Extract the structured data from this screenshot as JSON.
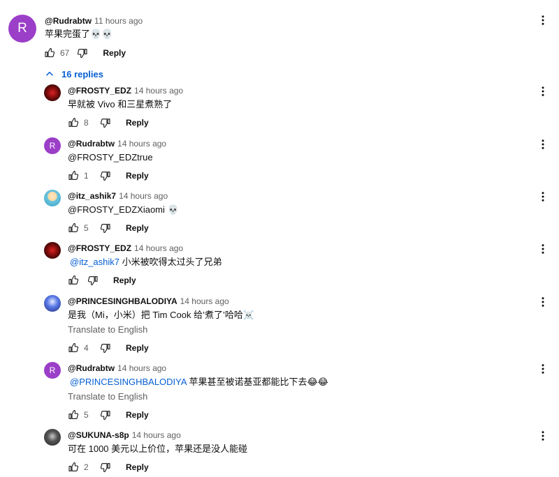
{
  "top_comment": {
    "avatar_letter": "R",
    "author": "@Rudrabtw",
    "time": "11 hours ago",
    "text": "苹果完蛋了💀💀",
    "likes": "67",
    "reply_label": "Reply"
  },
  "replies_toggle": {
    "label": "16 replies"
  },
  "replies": [
    {
      "author": "@FROSTY_EDZ",
      "time": "14 hours ago",
      "mention": "",
      "text": "早就被 Vivo 和三星煮熟了",
      "translate": "",
      "likes": "8",
      "reply_label": "Reply"
    },
    {
      "avatar_letter": "R",
      "author": "@Rudrabtw",
      "time": "14 hours ago",
      "mention": "",
      "text": "@FROSTY_EDZtrue",
      "translate": "",
      "likes": "1",
      "reply_label": "Reply"
    },
    {
      "author": "@itz_ashik7",
      "time": "14 hours ago",
      "mention": "",
      "text": "@FROSTY_EDZXiaomi 💀",
      "translate": "",
      "likes": "5",
      "reply_label": "Reply"
    },
    {
      "author": "@FROSTY_EDZ",
      "time": "14 hours ago",
      "mention": "@itz_ashik7",
      "text": " 小米被吹得太过头了兄弟",
      "translate": "",
      "likes": "",
      "reply_label": "Reply"
    },
    {
      "author": "@PRINCESINGHBALODIYA",
      "time": "14 hours ago",
      "mention": "",
      "text": "是我（Mi，小米）把 Tim Cook 给’煮了’哈哈☠️",
      "translate": "Translate to English",
      "likes": "4",
      "reply_label": "Reply"
    },
    {
      "avatar_letter": "R",
      "author": "@Rudrabtw",
      "time": "14 hours ago",
      "mention": "@PRINCESINGHBALODIYA",
      "text": " 苹果甚至被诺基亚都能比下去😂😂",
      "translate": "Translate to English",
      "likes": "5",
      "reply_label": "Reply"
    },
    {
      "author": "@SUKUNA-s8p",
      "time": "14 hours ago",
      "mention": "",
      "text": "可在 1000 美元以上价位，苹果还是没人能碰",
      "translate": "",
      "likes": "2",
      "reply_label": "Reply"
    }
  ],
  "colors": {
    "link": "#065fd4",
    "secondary": "#606060",
    "avatar_purple": "#9b3ec8"
  }
}
